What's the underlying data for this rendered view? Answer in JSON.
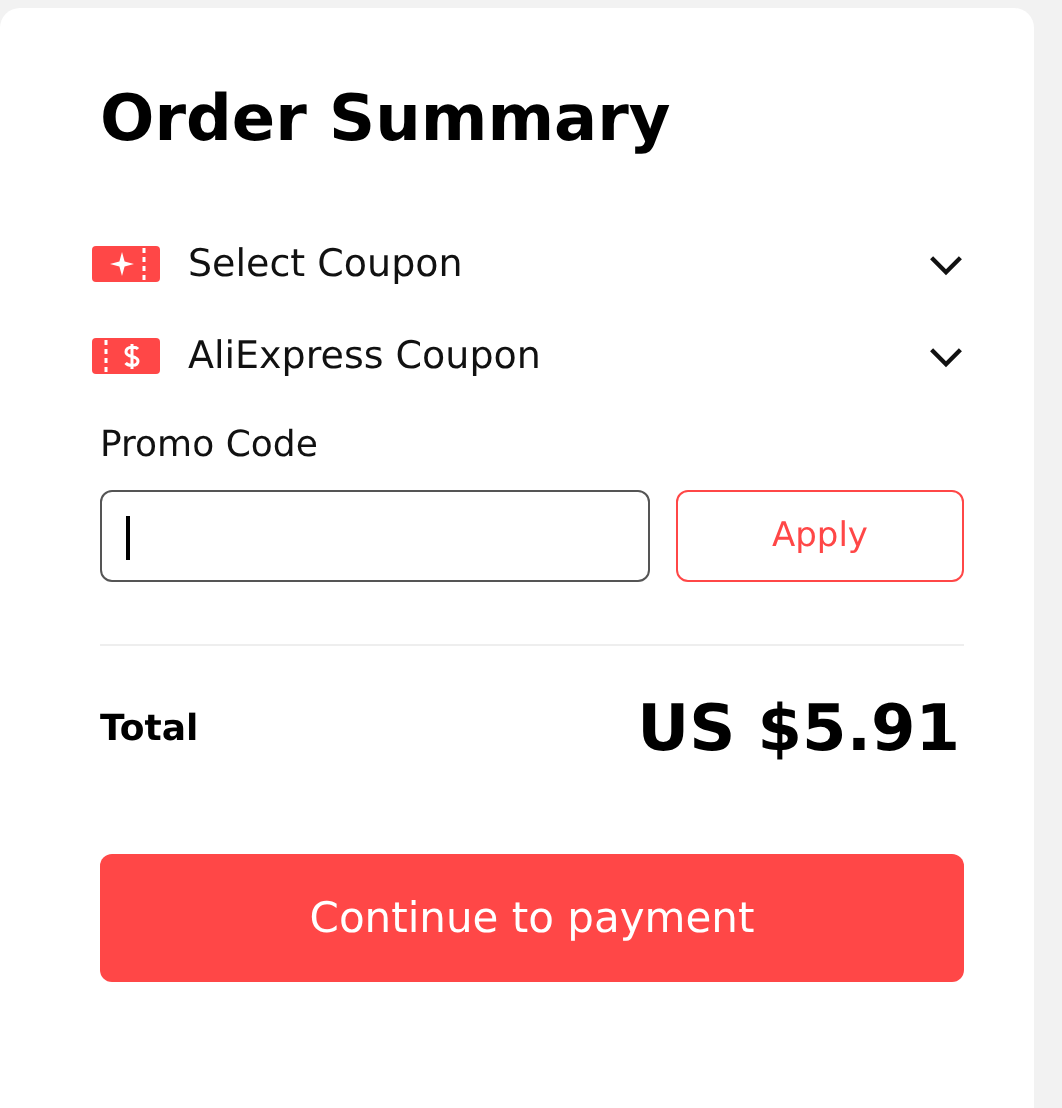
{
  "title": "Order Summary",
  "coupons": [
    {
      "label": "Select Coupon",
      "kind": "store",
      "expanded": false
    },
    {
      "label": "AliExpress Coupon",
      "kind": "platform",
      "expanded": false
    }
  ],
  "promo": {
    "label": "Promo Code",
    "focused": true,
    "button": "Apply"
  },
  "total": {
    "label": "Total",
    "amount": "US $5.91"
  },
  "primary_button": "Continue to payment"
}
